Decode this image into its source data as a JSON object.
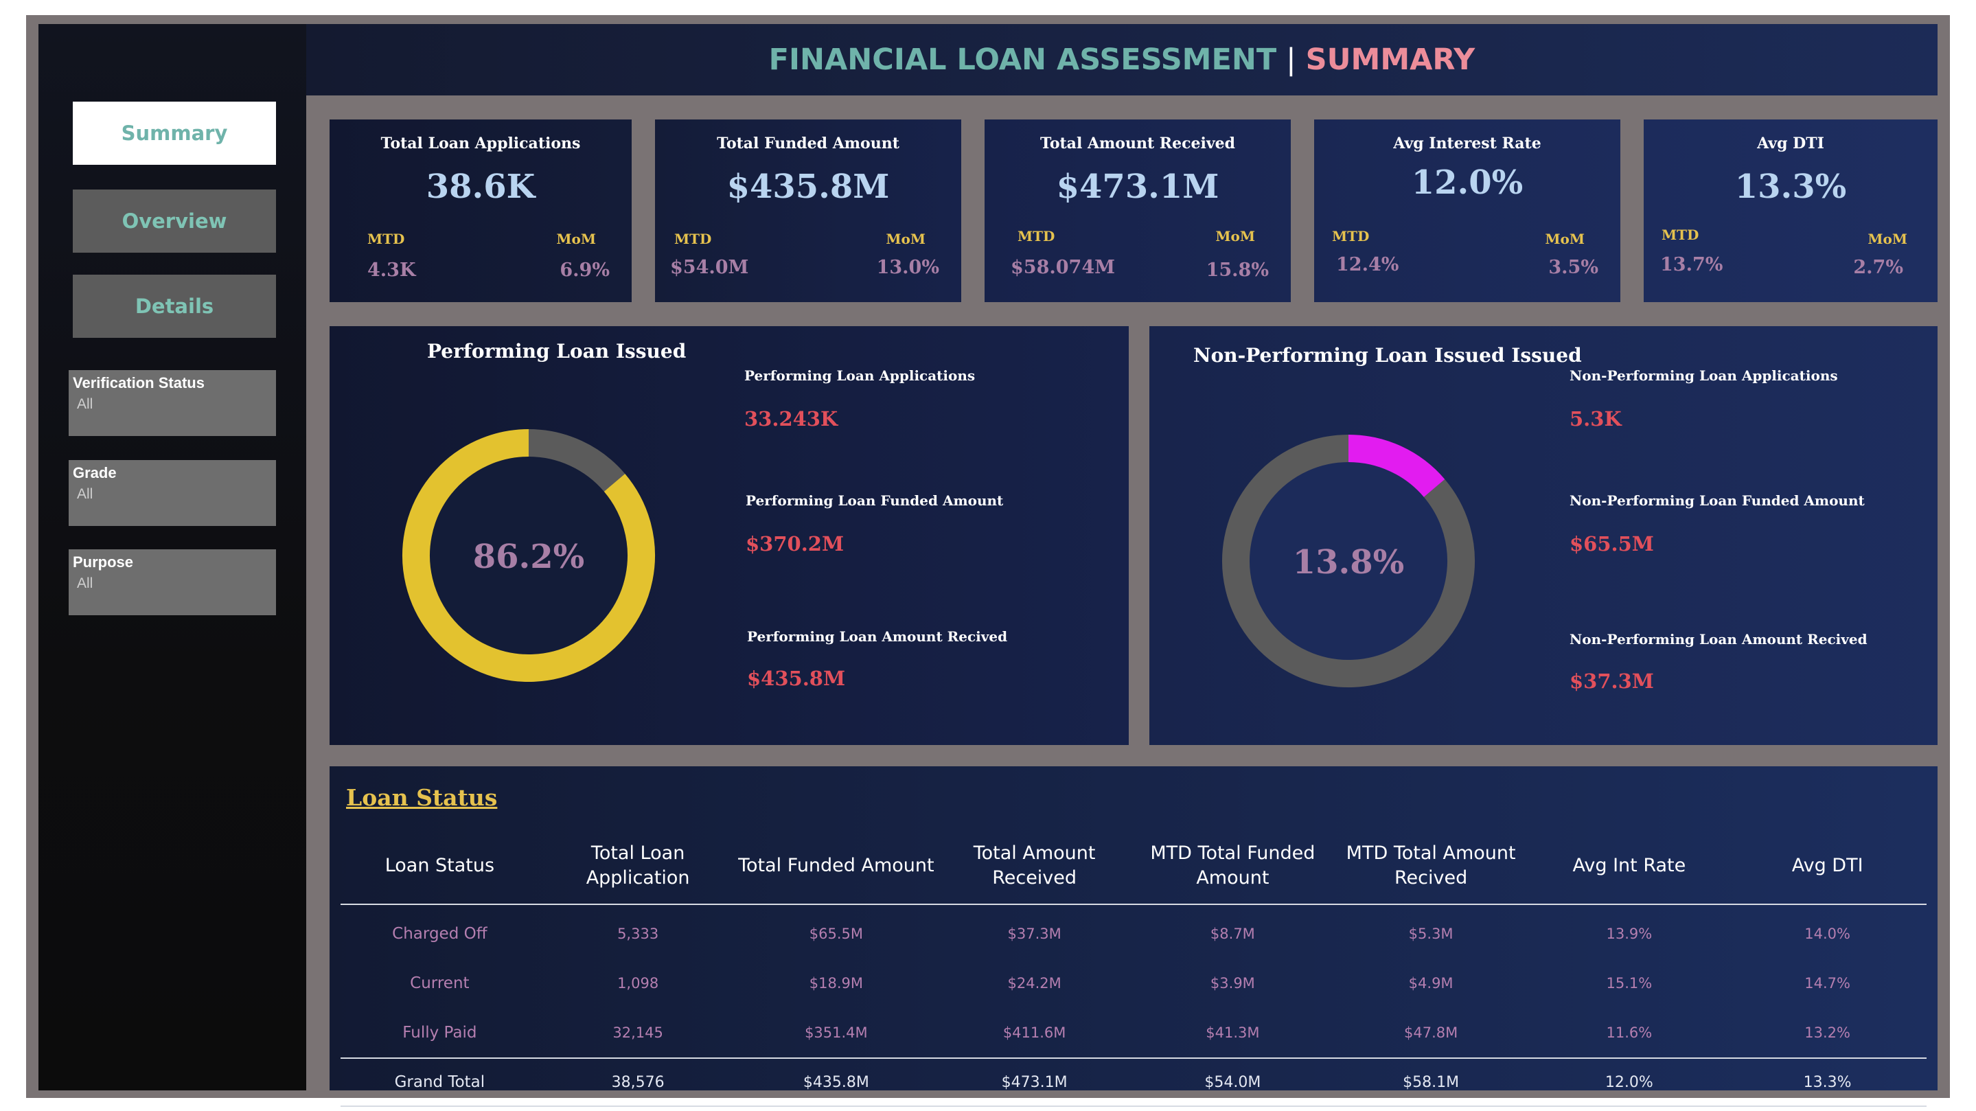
{
  "header": {
    "title_main": "FINANCIAL LOAN ASSESSMENT",
    "title_sep": "|",
    "title_page": "SUMMARY"
  },
  "nav": [
    {
      "label": "Summary",
      "active": true
    },
    {
      "label": "Overview",
      "active": false
    },
    {
      "label": "Details",
      "active": false
    }
  ],
  "filters": [
    {
      "label": "Verification Status",
      "value": "All"
    },
    {
      "label": "Grade",
      "value": "All"
    },
    {
      "label": "Purpose",
      "value": "All"
    }
  ],
  "kpis": [
    {
      "label": "Total Loan Applications",
      "value": "38.6K",
      "mtd_label": "MTD",
      "mtd": "4.3K",
      "mom_label": "MoM",
      "mom": "6.9%"
    },
    {
      "label": "Total Funded Amount",
      "value": "$435.8M",
      "mtd_label": "MTD",
      "mtd": "$54.0M",
      "mom_label": "MoM",
      "mom": "13.0%"
    },
    {
      "label": "Total Amount Received",
      "value": "$473.1M",
      "mtd_label": "MTD",
      "mtd": "$58.074M",
      "mom_label": "MoM",
      "mom": "15.8%"
    },
    {
      "label": "Avg Interest Rate",
      "value": "12.0%",
      "mtd_label": "MTD",
      "mtd": "12.4%",
      "mom_label": "MoM",
      "mom": "3.5%"
    },
    {
      "label": "Avg DTI",
      "value": "13.3%",
      "mtd_label": "MTD",
      "mtd": "13.7%",
      "mom_label": "MoM",
      "mom": "2.7%"
    }
  ],
  "performing": {
    "title": "Performing Loan Issued",
    "percent_label": "86.2%",
    "percent": 0.862,
    "ring_color": "#e3c22f",
    "rest_color": "#5b5b5b",
    "metrics": [
      {
        "label": "Performing Loan Applications",
        "value": "33.243K"
      },
      {
        "label": "Performing Loan Funded Amount",
        "value": "$370.2M"
      },
      {
        "label": "Performing Loan Amount Recived",
        "value": "$435.8M"
      }
    ]
  },
  "nonperforming": {
    "title": "Non-Performing Loan Issued Issued",
    "percent_label": "13.8%",
    "percent": 0.138,
    "ring_color": "#e21cf0",
    "rest_color": "#5b5b5b",
    "metrics": [
      {
        "label": "Non-Performing Loan Applications",
        "value": "5.3K"
      },
      {
        "label": "Non-Performing Loan Funded Amount",
        "value": "$65.5M"
      },
      {
        "label": "Non-Performing Loan Amount Recived",
        "value": "$37.3M"
      }
    ]
  },
  "loan_status": {
    "title": "Loan Status",
    "headers": [
      "Loan Status",
      "Total Loan Application",
      "Total Funded Amount",
      "Total Amount Received",
      "MTD Total Funded Amount",
      "MTD Total Amount Recived",
      "Avg Int Rate",
      "Avg DTI"
    ],
    "rows": [
      [
        "Charged Off",
        "5,333",
        "$65.5M",
        "$37.3M",
        "$8.7M",
        "$5.3M",
        "13.9%",
        "14.0%"
      ],
      [
        "Current",
        "1,098",
        "$18.9M",
        "$24.2M",
        "$3.9M",
        "$4.9M",
        "15.1%",
        "14.7%"
      ],
      [
        "Fully Paid",
        "32,145",
        "$351.4M",
        "$411.6M",
        "$41.3M",
        "$47.8M",
        "11.6%",
        "13.2%"
      ]
    ],
    "total": [
      "Grand Total",
      "38,576",
      "$435.8M",
      "$473.1M",
      "$54.0M",
      "$58.1M",
      "12.0%",
      "13.3%"
    ]
  }
}
